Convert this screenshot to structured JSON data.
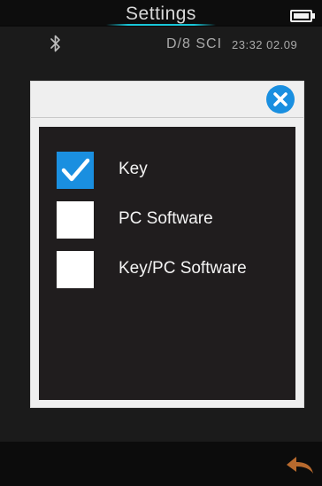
{
  "header": {
    "title": "Settings",
    "battery_icon": "battery-full-icon"
  },
  "status": {
    "bluetooth_icon": "bluetooth-icon",
    "mode": "D/8  SCI",
    "clock": "23:32 02.09"
  },
  "dialog": {
    "close_icon": "close-icon",
    "options": [
      {
        "label": "Key",
        "checked": true
      },
      {
        "label": "PC Software",
        "checked": false
      },
      {
        "label": "Key/PC Software",
        "checked": false
      }
    ]
  },
  "footer": {
    "back_icon": "back-arrow-icon"
  },
  "colors": {
    "accent": "#1a8fe0",
    "header_line": "#18c6d8"
  }
}
